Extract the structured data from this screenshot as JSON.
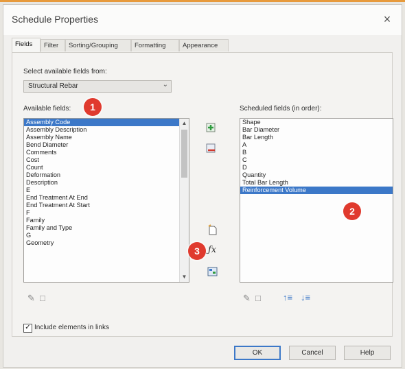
{
  "window": {
    "title": "Schedule Properties",
    "close_glyph": "×"
  },
  "tabs": [
    {
      "label": "Fields",
      "active": true
    },
    {
      "label": "Filter"
    },
    {
      "label": "Sorting/Grouping"
    },
    {
      "label": "Formatting"
    },
    {
      "label": "Appearance"
    }
  ],
  "select_fields": {
    "label": "Select available fields from:",
    "value": "Structural Rebar"
  },
  "available": {
    "label": "Available fields:",
    "items": [
      "Assembly Code",
      "Assembly Description",
      "Assembly Name",
      "Bend Diameter",
      "Comments",
      "Cost",
      "Count",
      "Deformation",
      "Description",
      "E",
      "End Treatment At End",
      "End Treatment At Start",
      "F",
      "Family",
      "Family and Type",
      "G",
      "Geometry"
    ],
    "selected_index": 0
  },
  "scheduled": {
    "label": "Scheduled fields (in order):",
    "items": [
      "Shape",
      "Bar Diameter",
      "Bar Length",
      "A",
      "B",
      "C",
      "D",
      "Quantity",
      "Total Bar Length",
      "Reinforcement Volume"
    ],
    "selected_index": 9
  },
  "badges": [
    "1",
    "2",
    "3"
  ],
  "icons": {
    "add": "add-field-icon",
    "remove": "remove-field-icon",
    "new_param": "new-parameter-icon",
    "calc": "calculated-value-icon",
    "combine": "combine-parameters-icon"
  },
  "include_links": {
    "label": "Include elements in links",
    "checked": true,
    "mark": "✓"
  },
  "buttons": {
    "ok": "OK",
    "cancel": "Cancel",
    "help": "Help"
  },
  "colors": {
    "selection": "#3c78c8",
    "badge": "#e03a2e",
    "accent_line": "#e79a3c"
  }
}
